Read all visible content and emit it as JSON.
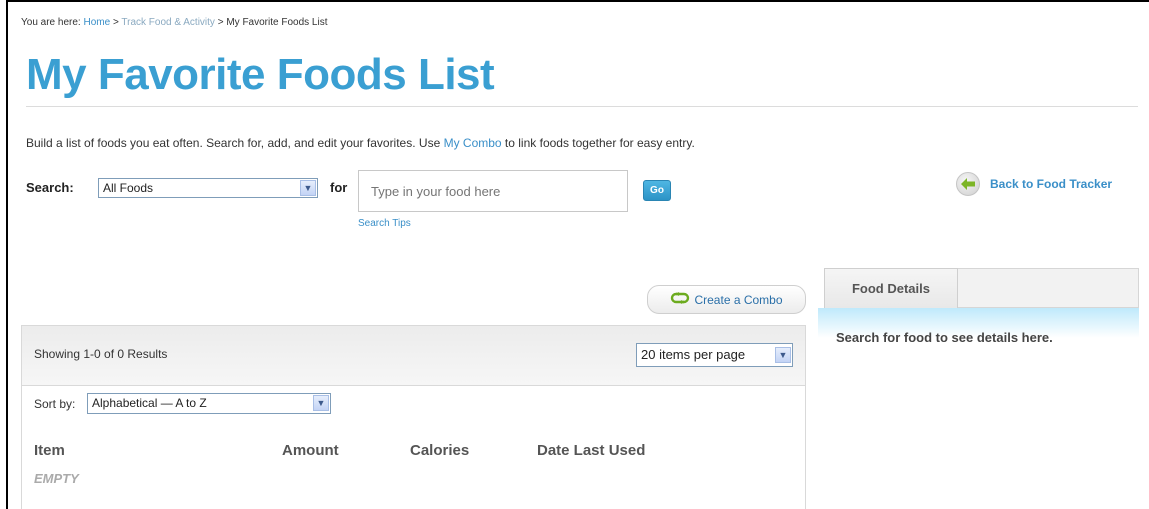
{
  "breadcrumb": {
    "prefix": "You are here:",
    "home": "Home",
    "sep1": ">",
    "track": "Track Food & Activity",
    "sep2": ">",
    "current": "My Favorite Foods List"
  },
  "page_title": "My Favorite Foods List",
  "intro": {
    "before": "Build a list of foods you eat often. Search for, add, and edit your favorites. Use ",
    "link": "My Combo",
    "after": " to link foods together for easy entry."
  },
  "search": {
    "label": "Search:",
    "category_selected": "All Foods",
    "for_label": "for",
    "placeholder": "Type in your food here",
    "go_label": "Go",
    "tips_label": "Search Tips"
  },
  "back_link": {
    "label": "Back to Food Tracker"
  },
  "combo_button": {
    "label": "Create a Combo"
  },
  "results": {
    "showing": "Showing 1-0 of 0 Results",
    "per_page_selected": "20 items per page",
    "sort_label": "Sort by:",
    "sort_selected": "Alphabetical — A to Z",
    "columns": [
      "Item",
      "Amount",
      "Calories",
      "Date Last Used"
    ],
    "empty": "EMPTY"
  },
  "details": {
    "tab_label": "Food Details",
    "message": "Search for food to see details here."
  },
  "colors": {
    "title_blue": "#3a9fd2",
    "link_blue": "#3a8fc8",
    "go_button": "#2b93c6",
    "details_band": "#bfe9fb",
    "back_arrow_green": "#7cb526"
  },
  "icons": {
    "select_arrow": "chevron-down-icon",
    "back": "back-arrow-icon",
    "combo": "combo-link-icon"
  }
}
